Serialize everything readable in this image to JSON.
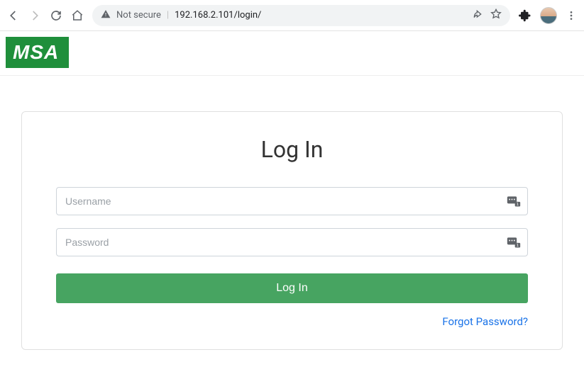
{
  "browser": {
    "not_secure_label": "Not secure",
    "url": "192.168.2.101/login/"
  },
  "header": {
    "logo_text": "MSA"
  },
  "login": {
    "title": "Log In",
    "username_placeholder": "Username",
    "username_value": "",
    "password_placeholder": "Password",
    "password_value": "",
    "submit_label": "Log In",
    "forgot_label": "Forgot Password?"
  }
}
